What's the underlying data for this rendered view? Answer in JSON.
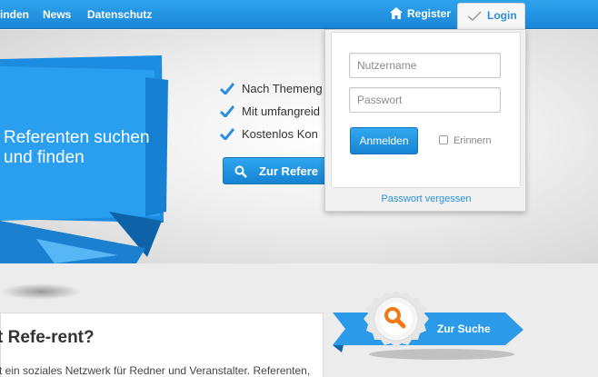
{
  "nav": {
    "links": [
      "inden",
      "News",
      "Datenschutz"
    ],
    "register_label": "Register",
    "login_label": "Login"
  },
  "hero": {
    "title": "Referenten suchen und finden",
    "features": [
      "Nach Themeng",
      "Mit umfangreid",
      "Kostenlos Kon"
    ],
    "search_button_label": "Zur Refere"
  },
  "login_panel": {
    "username_placeholder": "Nutzername",
    "password_placeholder": "Passwort",
    "submit_label": "Anmelden",
    "remember_label": "Erinnern",
    "forgot_link": "Passwort vergessen"
  },
  "content": {
    "heading": "t Refe-rent?",
    "text": "t ein soziales Netzwerk für Redner und Veranstalter. Referenten,"
  },
  "ribbon": {
    "label": "Zur Suche"
  },
  "colors": {
    "brand_blue": "#1e8fe0",
    "accent_orange": "#f07a1a"
  },
  "icons": [
    "home-icon",
    "checkmark-icon",
    "search-icon"
  ]
}
